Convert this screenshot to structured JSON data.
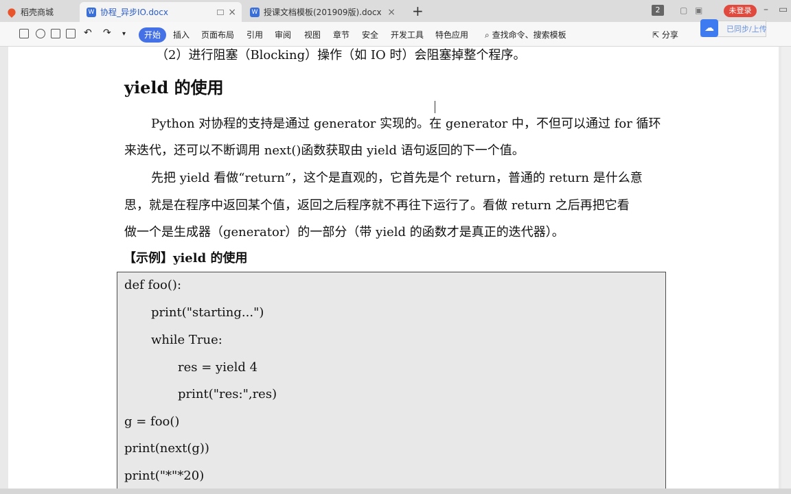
{
  "tabs": {
    "home": "稻壳商城",
    "doc1": "协程_异步IO.docx",
    "doc2": "授课文档模板(201909版).docx",
    "doc_icon": "W"
  },
  "window": {
    "badge": "2",
    "login": "未登录"
  },
  "ribbon": {
    "tabs": [
      "开始",
      "插入",
      "页面布局",
      "引用",
      "审阅",
      "视图",
      "章节",
      "安全",
      "开发工具",
      "特色应用"
    ],
    "search": "查找命令、搜索模板",
    "share": "分享",
    "cloud": "已同步/上传"
  },
  "doc": {
    "top_line": "（2）进行阻塞（Blocking）操作（如 IO 时）会阻塞掉整个程序。",
    "heading": "yield 的使用",
    "paragraphs": [
      "Python 对协程的支持是通过 generator 实现的。在 generator 中，不但可以通过 for 循环",
      "来迭代，还可以不断调用 next()函数获取由 yield 语句返回的下一个值。",
      "先把 yield 看做“return”，这个是直观的，它首先是个 return，普通的 return 是什么意",
      "思，就是在程序中返回某个值，返回之后程序就不再往下运行了。看做 return 之后再把它看",
      "做一个是生成器（generator）的一部分（带 yield 的函数才是真正的迭代器）。"
    ],
    "example_title": "【示例】yield 的使用",
    "code": [
      "def foo():",
      "print(\"starting...\")",
      "while True:",
      "res = yield 4",
      "print(\"res:\",res)",
      "g = foo()",
      "print(next(g))",
      "print(\"*\"*20)"
    ]
  }
}
